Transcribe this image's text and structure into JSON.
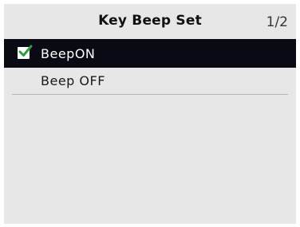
{
  "header": {
    "title": "Key Beep Set",
    "page_indicator": "1/2"
  },
  "menu": {
    "items": [
      {
        "label": "BeepON",
        "selected": true,
        "checked": true,
        "icon": "checkmark-icon"
      },
      {
        "label": "Beep OFF",
        "selected": false,
        "checked": false
      }
    ]
  },
  "colors": {
    "background": "#e7e7e7",
    "selected_row": "#0a0a14",
    "check_green": "#2e9e3e"
  }
}
